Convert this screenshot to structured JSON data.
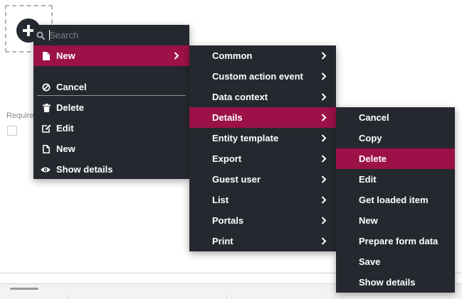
{
  "background": {
    "required_label": "Required"
  },
  "menu_main": {
    "search": {
      "placeholder": "Search"
    },
    "new_item": {
      "label": "New",
      "icon": "file-icon"
    },
    "actions": [
      {
        "label": "Cancel",
        "icon": "ban-icon"
      },
      {
        "label": "Delete",
        "icon": "trash-icon"
      },
      {
        "label": "Edit",
        "icon": "edit-icon"
      },
      {
        "label": "New",
        "icon": "file-icon"
      },
      {
        "label": "Show details",
        "icon": "eye-icon"
      }
    ]
  },
  "menu_categories": {
    "items": [
      "Common",
      "Custom action event",
      "Data context",
      "Details",
      "Entity template",
      "Export",
      "Guest user",
      "List",
      "Portals",
      "Print"
    ],
    "active": "Details"
  },
  "menu_details": {
    "items": [
      "Cancel",
      "Copy",
      "Delete",
      "Edit",
      "Get loaded item",
      "New",
      "Prepare form data",
      "Save",
      "Show details"
    ],
    "active": "Delete"
  },
  "colors": {
    "menu_bg": "#25292f",
    "active_bg": "#9c1148",
    "text": "#ffffff"
  }
}
